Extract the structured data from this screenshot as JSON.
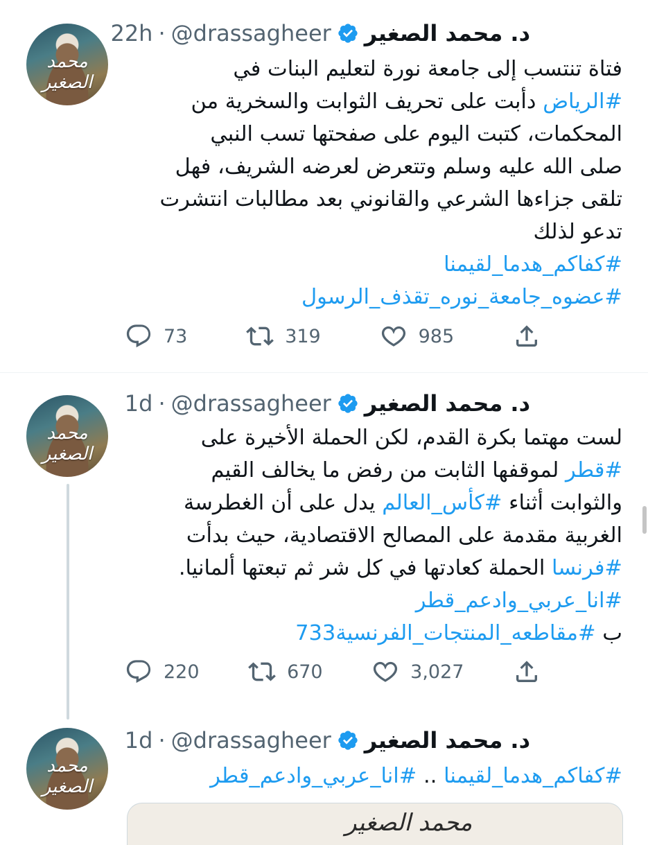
{
  "author": {
    "name": "د. محمد الصغير",
    "handle": "@drassagheer",
    "dot": "·",
    "avatar_signature": "محمد الصغير"
  },
  "tweets": [
    {
      "time": "22h",
      "lines": [
        [
          {
            "t": "فتاة تنتسب إلى جامعة نورة لتعليم البنات في"
          }
        ],
        [
          {
            "t": "#الرياض",
            "tag": true
          },
          {
            "t": " دأبت على تحريف الثوابت والسخرية من"
          }
        ],
        [
          {
            "t": "المحكمات، كتبت اليوم على صفحتها تسب النبي"
          }
        ],
        [
          {
            "t": "صلى الله عليه وسلم وتتعرض لعرضه الشريف، فهل"
          }
        ],
        [
          {
            "t": "تلقى جزاءها الشرعي والقانوني بعد مطالبات انتشرت"
          }
        ],
        [
          {
            "t": "تدعو لذلك"
          }
        ],
        [
          {
            "t": "#كفاكم_هدما_لقيمنا",
            "tag": true
          }
        ],
        [
          {
            "t": "#عضوه_جامعة_نوره_تقذف_الرسول",
            "tag": true
          }
        ]
      ],
      "stats": {
        "replies": "73",
        "retweets": "319",
        "likes": "985"
      }
    },
    {
      "time": "1d",
      "lines": [
        [
          {
            "t": "لست مهتما بكرة القدم، لكن الحملة الأخيرة على"
          }
        ],
        [
          {
            "t": "#قطر",
            "tag": true
          },
          {
            "t": " لموقفها الثابت من رفض ما يخالف القيم"
          }
        ],
        [
          {
            "t": "والثوابت أثناء "
          },
          {
            "t": "#كأس_العالم",
            "tag": true
          },
          {
            "t": " يدل على أن الغطرسة"
          }
        ],
        [
          {
            "t": "الغربية مقدمة على المصالح الاقتصادية، حيث بدأت"
          }
        ],
        [
          {
            "t": "#فرنسا",
            "tag": true
          },
          {
            "t": " الحملة كعادتها في كل شر ثم تبعتها ألمانيا."
          }
        ],
        [
          {
            "t": "#انا_عربي_وادعم_قطر",
            "tag": true
          }
        ],
        [
          {
            "t": "ب "
          },
          {
            "t": "#مقاطعه_المنتجات_الفرنسية733",
            "tag": true
          }
        ]
      ],
      "stats": {
        "replies": "220",
        "retweets": "670",
        "likes": "3,027"
      }
    },
    {
      "time": "1d",
      "lines": [
        [
          {
            "t": "#كفاكم_هدما_لقيمنا",
            "tag": true
          },
          {
            "t": " .. "
          },
          {
            "t": "#انا_عربي_وادعم_قطر",
            "tag": true
          }
        ]
      ]
    }
  ],
  "media": {
    "visible_text": "محمد الصغير"
  },
  "colors": {
    "link": "#1d9bf0",
    "secondary": "#536471",
    "verified": "#1d9bf0",
    "divider": "#eff3f4",
    "thread_line": "#cfd9de"
  },
  "icons": {
    "reply": "speech-bubble-icon",
    "retweet": "retweet-arrows-icon",
    "like": "heart-icon",
    "share": "share-upload-icon",
    "verified": "verified-badge-icon"
  }
}
